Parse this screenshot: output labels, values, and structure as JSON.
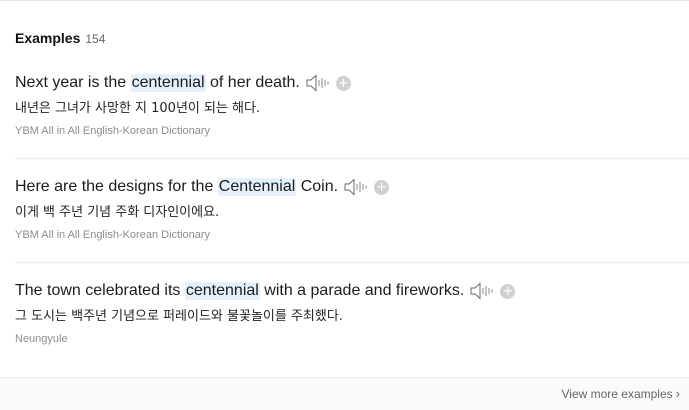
{
  "header": {
    "title": "Examples",
    "count": "154"
  },
  "examples": [
    {
      "before": "Next year is the ",
      "highlight": "centennial",
      "after": " of her death.",
      "translation": "내년은 그녀가 사망한 지 100년이 되는 해다.",
      "source": "YBM All in All English-Korean Dictionary"
    },
    {
      "before": "Here are the designs for the ",
      "highlight": "Centennial",
      "after": " Coin.",
      "translation": "이게 백 주년 기념 주화 디자인이에요.",
      "source": "YBM All in All English-Korean Dictionary"
    },
    {
      "before": "The town celebrated its ",
      "highlight": "centennial",
      "after": " with a parade and fireworks.",
      "translation": "그 도시는 백주년 기념으로 퍼레이드와 불꽃놀이를 주최했다.",
      "source": "Neungyule"
    }
  ],
  "footer": {
    "view_more": "View more examples",
    "chevron": "›"
  },
  "icons": {
    "speaker": "speaker-icon",
    "add": "plus-icon"
  },
  "colors": {
    "highlight": "#e4f0fb",
    "add_button": "#d0d0d0"
  }
}
